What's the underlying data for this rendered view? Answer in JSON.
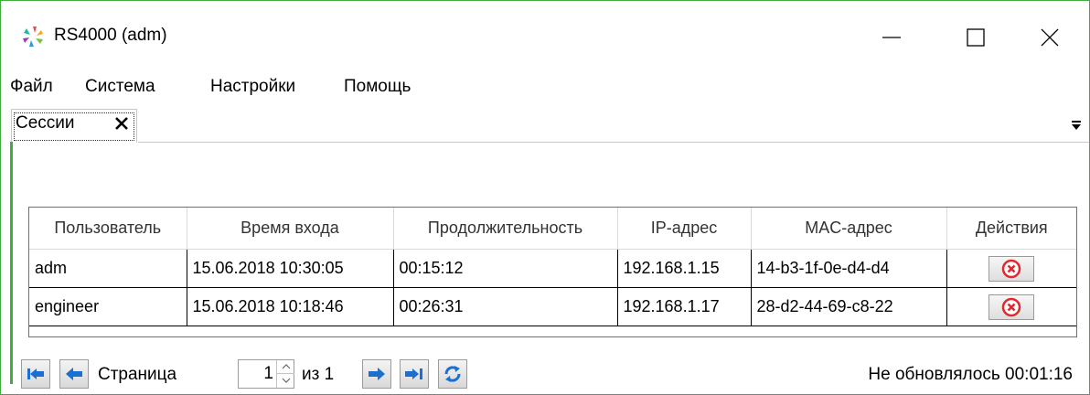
{
  "window": {
    "title": "RS4000 (adm)",
    "minimize_icon": "minimize-icon",
    "maximize_icon": "maximize-icon",
    "close_icon": "close-icon"
  },
  "menu": {
    "items": [
      "Файл",
      "Система",
      "Настройки",
      "Помощь"
    ]
  },
  "tabs": {
    "items": [
      {
        "label": "Сессии",
        "active": true
      }
    ]
  },
  "grid": {
    "columns": [
      "Пользователь",
      "Время входа",
      "Продолжительность",
      "IP-адрес",
      "MAC-адрес",
      "Действия"
    ],
    "rows": [
      {
        "user": "adm",
        "login_time": "15.06.2018 10:30:05",
        "duration": "00:15:12",
        "ip": "192.168.1.15",
        "mac": "14-b3-1f-0e-d4-d4"
      },
      {
        "user": "engineer",
        "login_time": "15.06.2018 10:18:46",
        "duration": "00:26:31",
        "ip": "192.168.1.17",
        "mac": "28-d2-44-69-c8-22"
      }
    ]
  },
  "pager": {
    "page_label": "Страница",
    "current_page": "1",
    "of_label": "из 1",
    "status": "Не обновлялось 00:01:16"
  },
  "colors": {
    "accent_green": "#3fae3f",
    "nav_blue": "#1a6fd1",
    "kill_red": "#e0282e"
  }
}
